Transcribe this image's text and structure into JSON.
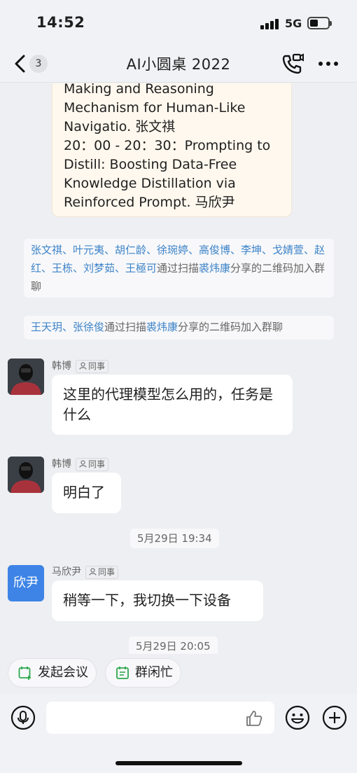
{
  "status_bar": {
    "time": "14:52",
    "network": "5G"
  },
  "nav": {
    "unread_count": "3",
    "title": "AI小圆桌 2022"
  },
  "schedule_message": {
    "text": "Making and Reasoning\nMechanism for Human-Like\nNavigatio. 张文祺\n20：00 - 20：30：Prompting to\nDistill: Boosting Data-Free\nKnowledge Distillation via\nReinforced Prompt. 马欣尹"
  },
  "system_notices": [
    {
      "names": "张文祺、叶元夷、胡仁龄、徐琬婷、高俊博、李坤、戈婧萱、赵红、王栋、刘梦茹、王極可",
      "mid": "通过扫描",
      "sharer": "裘炜康",
      "tail": "分享的二维码加入群聊"
    },
    {
      "names": "王天玥、张徐俊",
      "mid": "通过扫描",
      "sharer": "裘炜康",
      "tail": "分享的二维码加入群聊"
    }
  ],
  "messages": [
    {
      "sender": "韩博",
      "tag": "同事",
      "text": "这里的代理模型怎么用的，任务是什么"
    },
    {
      "sender": "韩博",
      "tag": "同事",
      "text": "明白了"
    },
    {
      "sender": "马欣尹",
      "tag": "同事",
      "avatar_text": "欣尹",
      "text": "稍等一下，我切换一下设备"
    }
  ],
  "time_dividers": [
    "5月29日 19:34",
    "5月29日 20:05"
  ],
  "quick_actions": {
    "meeting": "发起会议",
    "busy": "群闲忙"
  },
  "input": {
    "placeholder": ""
  },
  "colors": {
    "accent": "#3d83c8",
    "avatar_blue": "#3d84e6",
    "green_icon": "#2fa84f"
  }
}
